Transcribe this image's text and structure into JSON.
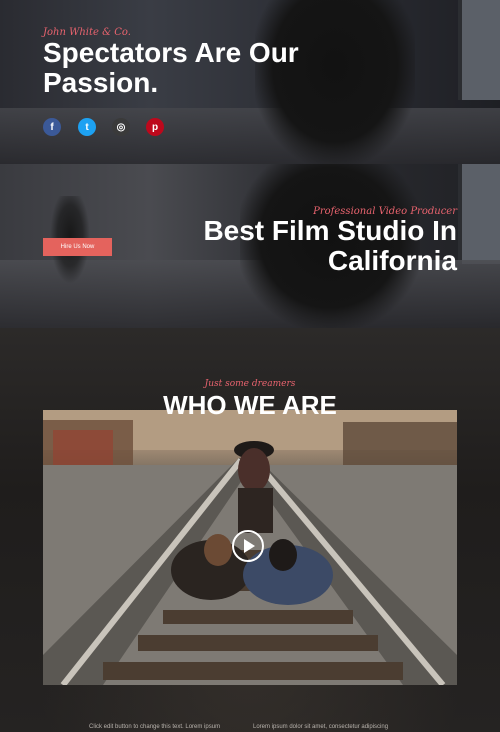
{
  "hero_top": {
    "subtitle": "John White & Co.",
    "title": "Spectators Are Our Passion.",
    "social": [
      {
        "name": "facebook-icon",
        "glyph": "f",
        "color": "#3b5998"
      },
      {
        "name": "twitter-icon",
        "glyph": "t",
        "color": "#1da1f2"
      },
      {
        "name": "instagram-icon",
        "glyph": "◎",
        "color": "#3a3a3a"
      },
      {
        "name": "pinterest-icon",
        "glyph": "p",
        "color": "#bd081c"
      }
    ]
  },
  "hero_second": {
    "subtitle": "Professional Video Producer",
    "title": "Best Film Studio In California",
    "cta_label": "Hire Us Now"
  },
  "about": {
    "subtitle": "Just some dreamers",
    "title": "WHO WE ARE",
    "play_icon": "play-icon",
    "text_left": "Click edit button to change this text. Lorem ipsum",
    "text_right": "Lorem ipsum dolor sit amet, consectetur adipiscing"
  },
  "colors": {
    "accent": "#e8636e",
    "button": "#e4635d",
    "text": "#ffffff"
  }
}
